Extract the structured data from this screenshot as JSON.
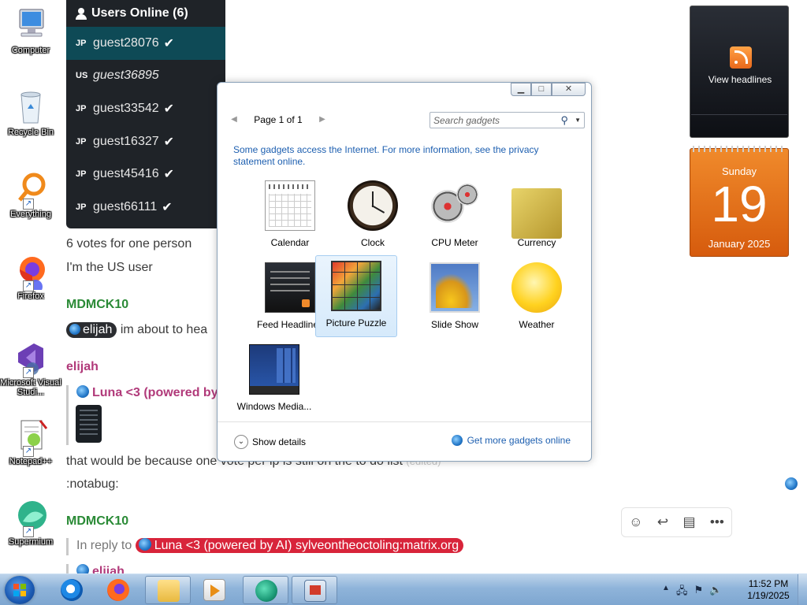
{
  "desktop": {
    "icons": [
      {
        "label": "Computer"
      },
      {
        "label": "Recycle Bin"
      },
      {
        "label": "Everything"
      },
      {
        "label": "Firefox"
      },
      {
        "label": "Microsoft Visual Studi..."
      },
      {
        "label": "Notepad++"
      },
      {
        "label": "Supermium"
      }
    ]
  },
  "users_panel": {
    "title": "Users Online (6)",
    "users": [
      {
        "country": "JP",
        "name": "guest28076",
        "check": "✔"
      },
      {
        "country": "US",
        "name": "guest36895",
        "check": ""
      },
      {
        "country": "JP",
        "name": "guest33542",
        "check": "✔"
      },
      {
        "country": "JP",
        "name": "guest16327",
        "check": "✔"
      },
      {
        "country": "JP",
        "name": "guest45416",
        "check": "✔"
      },
      {
        "country": "JP",
        "name": "guest66111",
        "check": "✔"
      }
    ]
  },
  "chat": {
    "line1": "6 votes for one person",
    "line2": "I'm the US user",
    "author1": "MDMCK10",
    "mention1": "elijah",
    "msg1": "im about to hea",
    "author2": "elijah",
    "quote_name": "Luna <3 (powered by",
    "msg2_a": "that would be because one",
    "msg2_b": "vote per ip is still on the to do list",
    "msg2_edited": "(edited)",
    "msg3": ":notabug:",
    "author3": "MDMCK10",
    "reply_prefix": "In reply to",
    "reply_target": "Luna <3 (powered by AI) sylveontheoctoling:matrix.org",
    "author4_partial": "elijah"
  },
  "sidebar": {
    "rss_label": "View headlines",
    "calendar": {
      "day": "Sunday",
      "date": "19",
      "month_year": "January 2025"
    }
  },
  "gallery": {
    "pager": "Page 1 of 1",
    "search_placeholder": "Search gadgets",
    "notice": "Some gadgets access the Internet.  For more information, see the privacy statement online.",
    "gadgets": [
      {
        "name": "Calendar"
      },
      {
        "name": "Clock"
      },
      {
        "name": "CPU Meter"
      },
      {
        "name": "Currency"
      },
      {
        "name": "Feed Headlines"
      },
      {
        "name": "Picture Puzzle"
      },
      {
        "name": "Slide Show"
      },
      {
        "name": "Weather"
      },
      {
        "name": "Windows Media..."
      }
    ],
    "selected": "Picture Puzzle",
    "show_details": "Show details",
    "more_online": "Get more gadgets online"
  },
  "taskbar": {
    "time": "11:52 PM",
    "date": "1/19/2025"
  }
}
